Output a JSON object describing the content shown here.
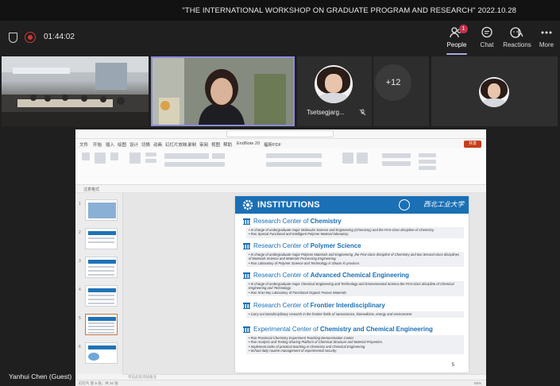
{
  "banner": {
    "title": "\"THE INTERNATIONAL WORKSHOP ON GRADUATE PROGRAM AND RESEARCH\" 2022.10.28"
  },
  "topbar": {
    "timer": "01:44:02",
    "buttons": {
      "people": {
        "label": "People",
        "badge": "1"
      },
      "chat": {
        "label": "Chat"
      },
      "reactions": {
        "label": "Reactions"
      },
      "more": {
        "label": "More"
      }
    }
  },
  "participants": {
    "tile3_name": "Tsetsegjarg...",
    "overflow_count": "+12",
    "guest_label": "Yanhui Chen (Guest)"
  },
  "ppt": {
    "tabs": [
      "文件",
      "开始",
      "插入",
      "绘图",
      "设计",
      "切换",
      "动画",
      "幻灯片放映",
      "录制",
      "审阅",
      "视图",
      "帮助",
      "EndNote 20",
      "福昕PDF"
    ],
    "share_label": "共享",
    "quick_label": "注意格式",
    "notes_placeholder": "单击此处添加备注",
    "slide_count_label": "幻灯片 第 5 张，共 20 张",
    "zoom": "65%",
    "thumb_numbers": [
      "1",
      "2",
      "3",
      "4",
      "5",
      "6"
    ]
  },
  "slide": {
    "title": "INSTITUTIONS",
    "logo_text": "西北工业大学",
    "page_number": "5",
    "sections": [
      {
        "prefix": "Research Center of ",
        "bold": "Chemistry",
        "bullets": [
          "In charge of undergraduate major Molecular Science and Engineering (Chemistry) and the First-class discipline of Chemistry.",
          "Run Special Functional and Intelligent Polymer Material laboratory."
        ]
      },
      {
        "prefix": "Research Center of ",
        "bold": "Polymer Science",
        "bullets": [
          "In charge of undergraduate major Polymer Materials and Engineering ,the First-class discipline of Chemistry and two Second-class disciplines of Materials Science and Materials Processing Engineering.",
          "Run Laboratory of Polymer Science and Technology in Shaan Xi province."
        ]
      },
      {
        "prefix": "Research Center of ",
        "bold": "Advanced Chemical Engineering",
        "bullets": [
          "In charge of undergraduate major Chemical Engineering and Technology and Environmental Science,the First-class discipline of Chemical Engineering and Technology.",
          "Run Xi'an key Laboratory of Functional Organic Porous Materials"
        ]
      },
      {
        "prefix": "Research Center of ",
        "bold": "Frontier Interdisciplinary",
        "bullets": [
          "Carry out interdisciplinary research in the frontier fields of nanoscience, biomedicine, energy and environment"
        ]
      },
      {
        "prefix": "Experimental Center of ",
        "bold": "Chemistry and Chemical Engineering",
        "bullets": [
          "Run Provincial Chemistry Experiment Teaching Demonstration Center",
          "Run Analysis and Testing Sharing Platform of Chemical Structure and Material Properties.",
          "Implement tasks of practical teaching in Chemistry and Chemical Engineering.",
          "School daily routine management of experimental security."
        ]
      }
    ]
  }
}
